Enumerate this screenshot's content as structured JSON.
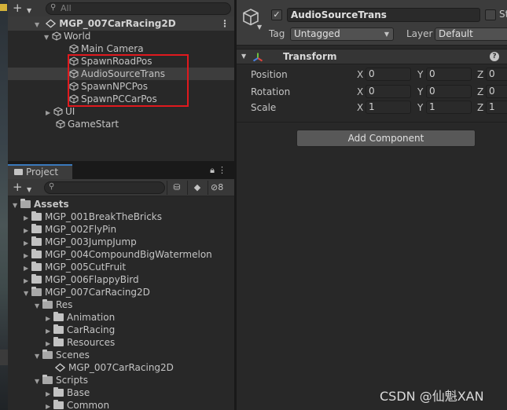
{
  "hierarchy": {
    "search_placeholder": "All",
    "scene_name": "MGP_007CarRacing2D",
    "items": [
      {
        "label": "World"
      },
      {
        "label": "Main Camera"
      },
      {
        "label": "SpawnRoadPos"
      },
      {
        "label": "AudioSourceTrans"
      },
      {
        "label": "SpawnNPCPos"
      },
      {
        "label": "SpawnPCCarPos"
      },
      {
        "label": "UI"
      },
      {
        "label": "GameStart"
      }
    ]
  },
  "project": {
    "tab_label": "Project",
    "hidden_count": "8",
    "tree": [
      {
        "label": "Assets"
      },
      {
        "label": "MGP_001BreakTheBricks"
      },
      {
        "label": "MGP_002FlyPin"
      },
      {
        "label": "MGP_003JumpJump"
      },
      {
        "label": "MGP_004CompoundBigWatermelon"
      },
      {
        "label": "MGP_005CutFruit"
      },
      {
        "label": "MGP_006FlappyBird"
      },
      {
        "label": "MGP_007CarRacing2D"
      },
      {
        "label": "Res"
      },
      {
        "label": "Animation"
      },
      {
        "label": "CarRacing"
      },
      {
        "label": "Resources"
      },
      {
        "label": "Scenes"
      },
      {
        "label": "MGP_007CarRacing2D"
      },
      {
        "label": "Scripts"
      },
      {
        "label": "Base"
      },
      {
        "label": "Common"
      }
    ]
  },
  "inspector": {
    "object_name": "AudioSourceTrans",
    "static_label": "St",
    "tag_label": "Tag",
    "tag_value": "Untagged",
    "layer_label": "Layer",
    "layer_value": "Default",
    "transform": {
      "title": "Transform",
      "rows": [
        {
          "label": "Position",
          "x": "0",
          "y": "0",
          "z": "0"
        },
        {
          "label": "Rotation",
          "x": "0",
          "y": "0",
          "z": "0"
        },
        {
          "label": "Scale",
          "x": "1",
          "y": "1",
          "z": "1"
        }
      ],
      "axis_x": "X",
      "axis_y": "Y",
      "axis_z": "Z"
    },
    "add_component_label": "Add Component"
  },
  "watermark": "CSDN @仙魁XAN",
  "colors": {
    "highlight_box": "#e0191e",
    "tab_accent": "#3a79bb"
  }
}
